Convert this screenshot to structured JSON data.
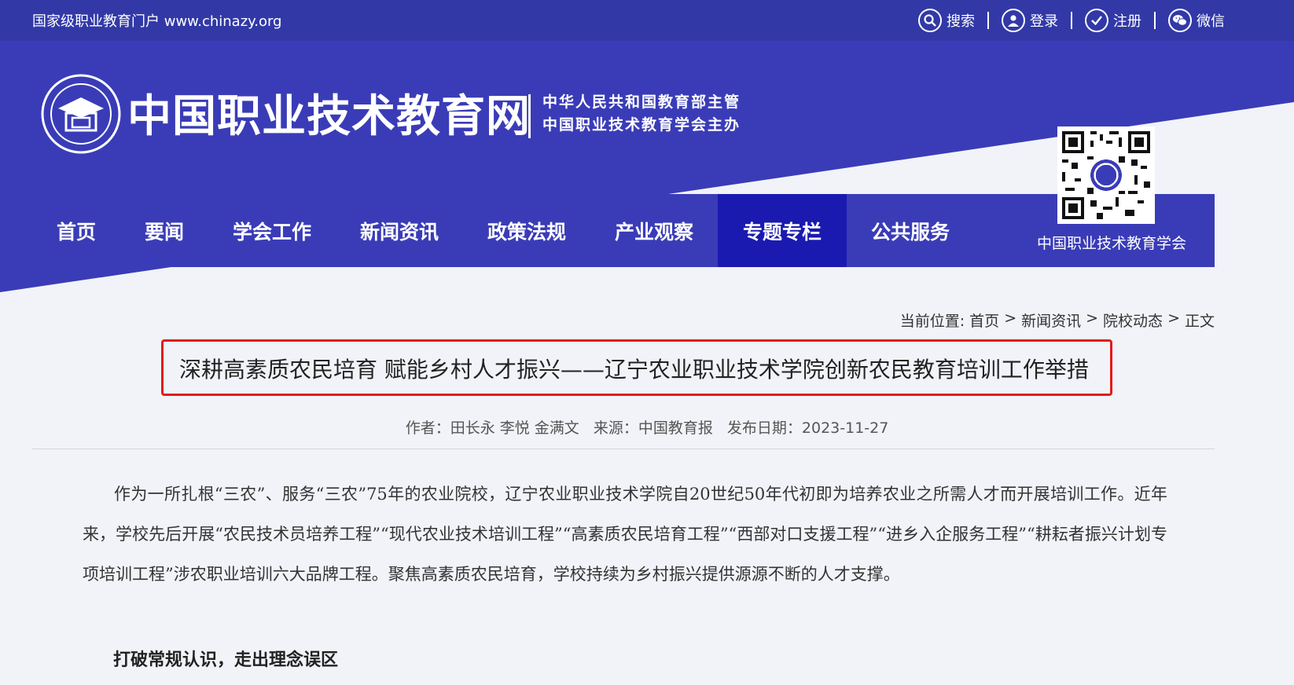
{
  "topbar": {
    "portal": "国家级职业教育门户 www.chinazy.org",
    "links": [
      "搜索",
      "登录",
      "注册",
      "微信"
    ]
  },
  "header": {
    "site_title": "中国职业技术教育网",
    "sponsor_line1": "中华人民共和国教育部主管",
    "sponsor_line2": "中国职业技术教育学会主办"
  },
  "nav": {
    "items": [
      "首页",
      "要闻",
      "学会工作",
      "新闻资讯",
      "政策法规",
      "产业观察",
      "专题专栏",
      "公共服务"
    ],
    "active": "专题专栏",
    "org": "中国职业技术教育学会"
  },
  "breadcrumb": {
    "label": "当前位置:",
    "items": [
      "首页",
      "新闻资讯",
      "院校动态",
      "正文"
    ],
    "sep": ">"
  },
  "article": {
    "title": "深耕高素质农民培育 赋能乡村人才振兴——辽宁农业职业技术学院创新农民教育培训工作举措",
    "author": "作者：田长永 李悦 金满文",
    "source": "来源：中国教育报",
    "date": "发布日期：2023-11-27",
    "paragraph": "作为一所扎根“三农”、服务“三农”75年的农业院校，辽宁农业职业技术学院自20世纪50年代初即为培养农业之所需人才而开展培训工作。近年来，学校先后开展“农民技术员培养工程”“现代农业技术培训工程”“高素质农民培育工程”“西部对口支援工程”“进乡入企服务工程”“耕耘者振兴计划专项培训工程”涉农职业培训六大品牌工程。聚焦高素质农民培育，学校持续为乡村振兴提供源源不断的人才支撑。",
    "subheading": "打破常规认识，走出理念误区"
  },
  "colors": {
    "primary": "#3a3cb7",
    "nav_active": "#1a1ab0",
    "highlight": "#e21b1b"
  }
}
